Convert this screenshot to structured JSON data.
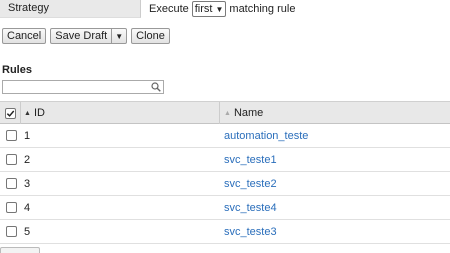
{
  "strategy": {
    "label": "Strategy",
    "prefix": "Execute",
    "selected": "first",
    "suffix": "matching rule"
  },
  "toolbar": {
    "cancel": "Cancel",
    "save_draft": "Save Draft",
    "clone": "Clone"
  },
  "rules": {
    "heading": "Rules",
    "filter_value": "",
    "columns": {
      "id": "ID",
      "name": "Name"
    },
    "rows": [
      {
        "id": "1",
        "name": "automation_teste",
        "checked": false
      },
      {
        "id": "2",
        "name": "svc_teste1",
        "checked": false
      },
      {
        "id": "3",
        "name": "svc_teste2",
        "checked": false
      },
      {
        "id": "4",
        "name": "svc_teste4",
        "checked": false
      },
      {
        "id": "5",
        "name": "svc_teste3",
        "checked": false
      }
    ]
  },
  "icons": {
    "filter": "search-icon",
    "sort_id": "sort-up-icon",
    "sort_name": "sort-both-icon",
    "select_all": "checkmark-icon"
  },
  "colors": {
    "link": "#2a6ebb",
    "header_bg": "#e8e8e8",
    "label_bg": "#e9e9e9"
  }
}
